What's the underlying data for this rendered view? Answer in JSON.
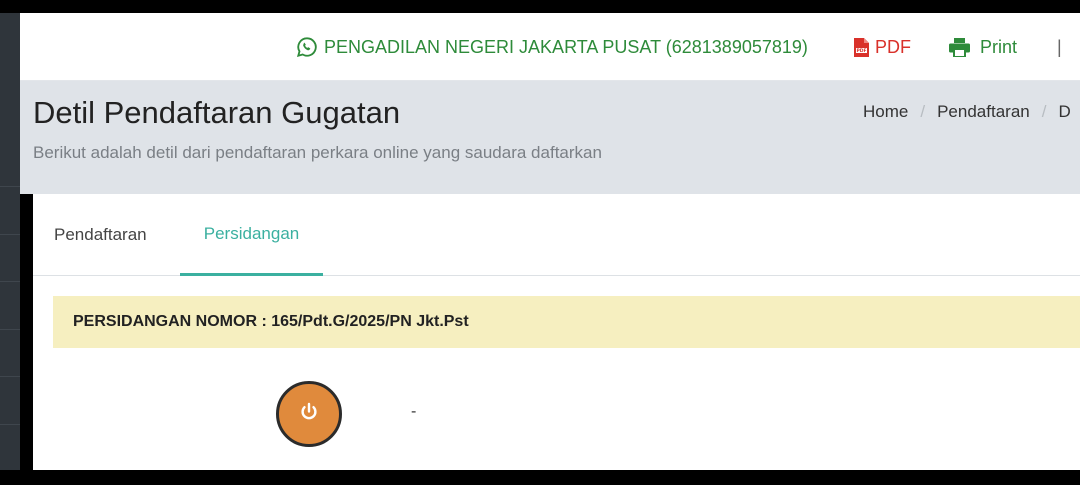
{
  "topbar": {
    "court_link": "PENGADILAN NEGERI JAKARTA PUSAT (6281389057819)",
    "pdf_label": "PDF",
    "print_label": "Print",
    "separator": "|"
  },
  "header": {
    "title": "Detil Pendaftaran Gugatan",
    "subtitle": "Berikut adalah detil dari pendaftaran perkara online yang saudara daftarkan",
    "breadcrumb": [
      "Home",
      "Pendaftaran",
      "D"
    ]
  },
  "tabs": [
    {
      "label": "Pendaftaran",
      "active": false
    },
    {
      "label": "Persidangan",
      "active": true
    }
  ],
  "notice": {
    "text": "PERSIDANGAN NOMOR : 165/Pdt.G/2025/PN Jkt.Pst"
  },
  "status": {
    "value": "-",
    "icon": "power-icon"
  },
  "colors": {
    "accent": "#3bb0a0",
    "whatsapp": "#2e8b3a",
    "pdf": "#d9312a",
    "notice_bg": "#f6efc0",
    "power_button": "#e08a3c"
  }
}
